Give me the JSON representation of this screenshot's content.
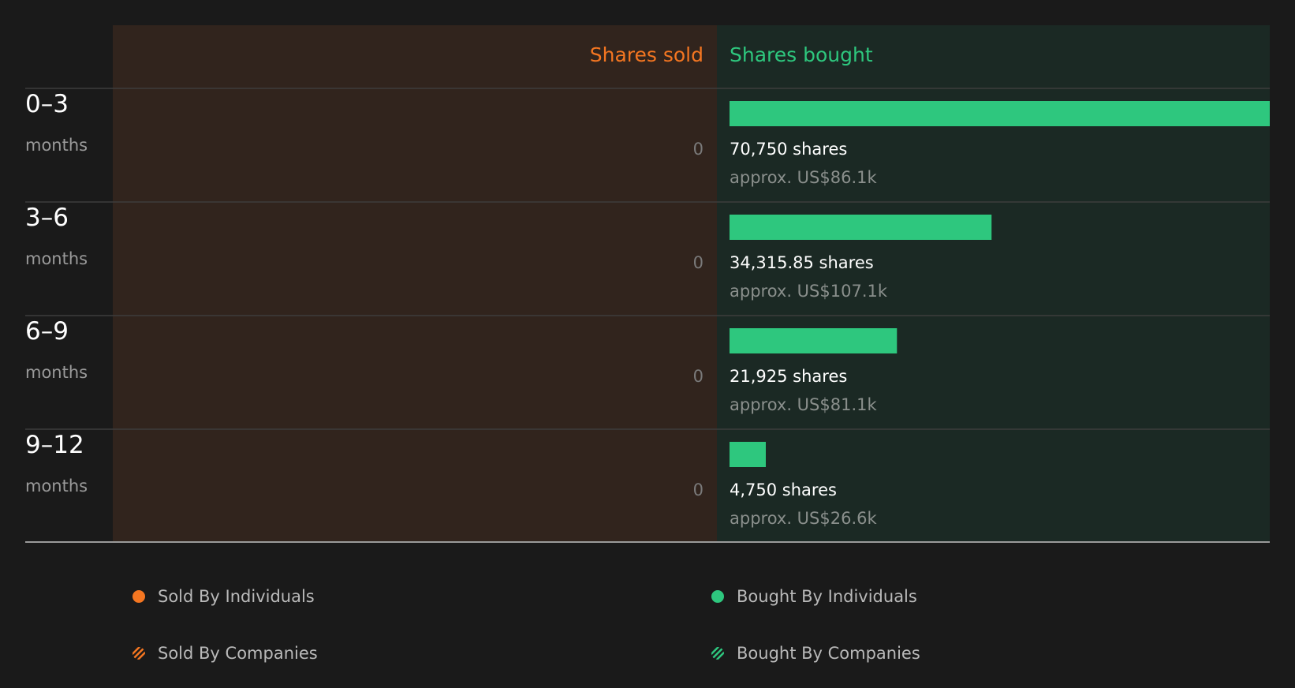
{
  "colors": {
    "sold": "#f47621",
    "bought": "#2ec77e",
    "sold_bg": "#31241d",
    "bought_bg": "#1b2924",
    "page_bg": "#1a1a1a"
  },
  "chart_data": {
    "type": "bar",
    "header": {
      "sold": "Shares sold",
      "bought": "Shares bought"
    },
    "rows": [
      {
        "period": "0–3",
        "unit": "months",
        "sold_value": 0,
        "sold_label": "0",
        "bought_shares": 70750,
        "bought_label": "70,750 shares",
        "bought_value_label": "approx. US$86.1k"
      },
      {
        "period": "3–6",
        "unit": "months",
        "sold_value": 0,
        "sold_label": "0",
        "bought_shares": 34315.85,
        "bought_label": "34,315.85 shares",
        "bought_value_label": "approx. US$107.1k"
      },
      {
        "period": "6–9",
        "unit": "months",
        "sold_value": 0,
        "sold_label": "0",
        "bought_shares": 21925,
        "bought_label": "21,925 shares",
        "bought_value_label": "approx. US$81.1k"
      },
      {
        "period": "9–12",
        "unit": "months",
        "sold_value": 0,
        "sold_label": "0",
        "bought_shares": 4750,
        "bought_label": "4,750 shares",
        "bought_value_label": "approx. US$26.6k"
      }
    ],
    "legend": {
      "sold_individuals": "Sold By Individuals",
      "bought_individuals": "Bought By Individuals",
      "sold_companies": "Sold By Companies",
      "bought_companies": "Bought By Companies"
    }
  }
}
